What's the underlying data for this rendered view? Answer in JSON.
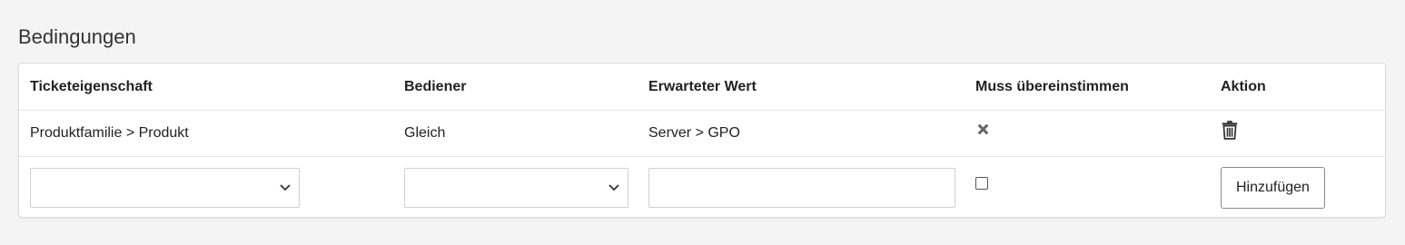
{
  "section": {
    "title": "Bedingungen"
  },
  "table": {
    "headers": {
      "property": "Ticketeigenschaft",
      "operator": "Bediener",
      "expected": "Erwarteter Wert",
      "must_match": "Muss übereinstimmen",
      "action": "Aktion"
    },
    "rows": [
      {
        "property": "Produktfamilie > Produkt",
        "operator": "Gleich",
        "expected": "Server > GPO",
        "must_match_icon": "x-icon",
        "action_icon": "trash-icon"
      }
    ],
    "new_row": {
      "property_value": "",
      "operator_value": "",
      "expected_value": "",
      "must_match_checked": false,
      "add_label": "Hinzufügen"
    }
  },
  "colors": {
    "icon": "#666666",
    "border": "#cfcfcf",
    "background": "#f4f4f4"
  }
}
